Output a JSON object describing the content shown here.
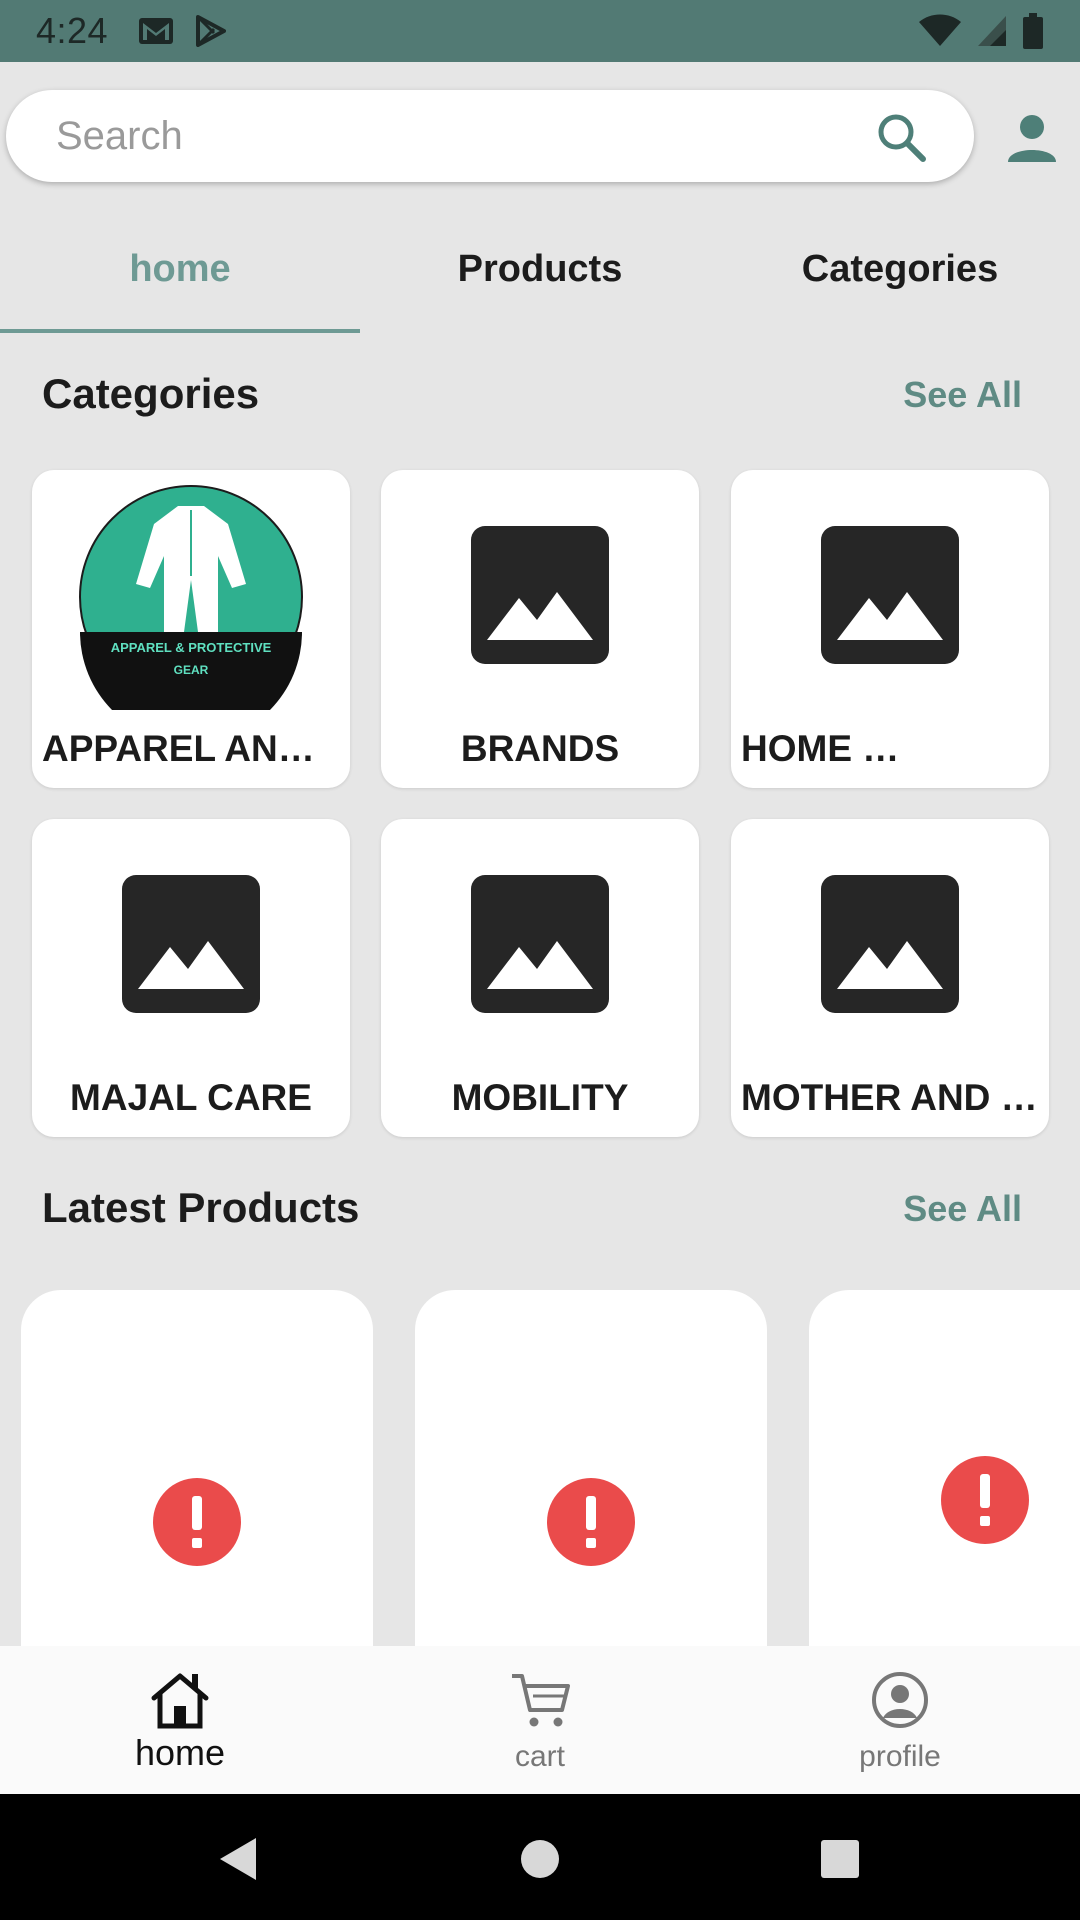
{
  "status_bar": {
    "time": "4:24",
    "left_icons": [
      "gmail-icon",
      "play-store-icon"
    ],
    "right_icons": [
      "wifi-icon",
      "cellular-signal-icon",
      "battery-icon"
    ]
  },
  "search": {
    "placeholder": "Search",
    "value": ""
  },
  "tabs": [
    {
      "label": "home",
      "active": true
    },
    {
      "label": "Products",
      "active": false
    },
    {
      "label": "Categories",
      "active": false
    }
  ],
  "categories_section": {
    "title": "Categories",
    "see_all": "See All",
    "items": [
      {
        "label": "APPAREL AND PROTECTIVE GEAR",
        "image": "apparel-logo",
        "logo_text_line1": "APPAREL & PROTECTIVE",
        "logo_text_line2": "GEAR"
      },
      {
        "label": "BRANDS",
        "image": "image-placeholder-icon"
      },
      {
        "label": "HOME …",
        "image": "image-placeholder-icon"
      },
      {
        "label": "MAJAL CARE",
        "image": "image-placeholder-icon"
      },
      {
        "label": "MOBILITY",
        "image": "image-placeholder-icon"
      },
      {
        "label": "MOTHER AND …",
        "image": "image-placeholder-icon"
      }
    ]
  },
  "latest_products_section": {
    "title": "Latest Products",
    "see_all": "See All",
    "items": [
      {
        "image": "error-icon"
      },
      {
        "image": "error-icon"
      },
      {
        "image": "error-icon"
      }
    ]
  },
  "bottom_nav": {
    "items": [
      {
        "label": "home",
        "icon": "home-icon",
        "active": true
      },
      {
        "label": "cart",
        "icon": "cart-icon",
        "active": false
      },
      {
        "label": "profile",
        "icon": "profile-icon",
        "active": false
      }
    ]
  },
  "system_nav": [
    "back-icon",
    "home-circle-icon",
    "recents-icon"
  ],
  "colors": {
    "status_bar": "#527a74",
    "accent": "#6e9a94",
    "see_all": "#5f8b84",
    "error": "#ea4b4b",
    "apparel_green": "#2fb08f"
  }
}
